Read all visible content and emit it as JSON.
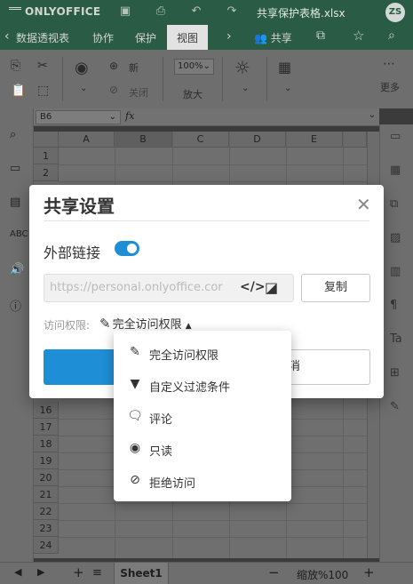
{
  "titlebar": {
    "logo": "ONLYOFFICE",
    "doc_title": "共享保护表格.xlsx",
    "avatar": "ZS"
  },
  "tabs": [
    {
      "label": "数据透视表"
    },
    {
      "label": "协作"
    },
    {
      "label": "保护"
    },
    {
      "label": "视图",
      "active": true
    }
  ],
  "share_button": {
    "label": "共享"
  },
  "toolbar": {
    "new_label": "新",
    "close_label": "关闭",
    "zoom_value": "100%",
    "zoom_label": "放大",
    "more_label": "更多"
  },
  "formula_bar": {
    "cell_ref": "B6",
    "fx": "fx"
  },
  "grid": {
    "columns": [
      "A",
      "B",
      "C",
      "D",
      "E"
    ],
    "selected_column": "B",
    "rows_top": [
      "1",
      "2"
    ],
    "rows_bottom": [
      "16",
      "17",
      "18",
      "19",
      "20",
      "21",
      "22",
      "23",
      "24"
    ]
  },
  "statusbar": {
    "sheet_name": "Sheet1",
    "zoom_text": "缩放%100"
  },
  "dialog": {
    "title": "共享设置",
    "external_link_label": "外部链接",
    "external_link_on": true,
    "link_url": "https://personal.onlyoffice.cor",
    "copy_label": "复制",
    "access_label": "访问权限:",
    "access_value": "完全访问权限",
    "cancel_label": "消",
    "accent_color": "#1e8fd6"
  },
  "access_menu": {
    "items": [
      {
        "icon": "pencil-icon",
        "label": "完全访问权限"
      },
      {
        "icon": "filter-icon",
        "label": "自定义过滤条件"
      },
      {
        "icon": "comment-icon",
        "label": "评论"
      },
      {
        "icon": "eye-icon",
        "label": "只读"
      },
      {
        "icon": "deny-icon",
        "label": "拒绝访问"
      }
    ]
  }
}
